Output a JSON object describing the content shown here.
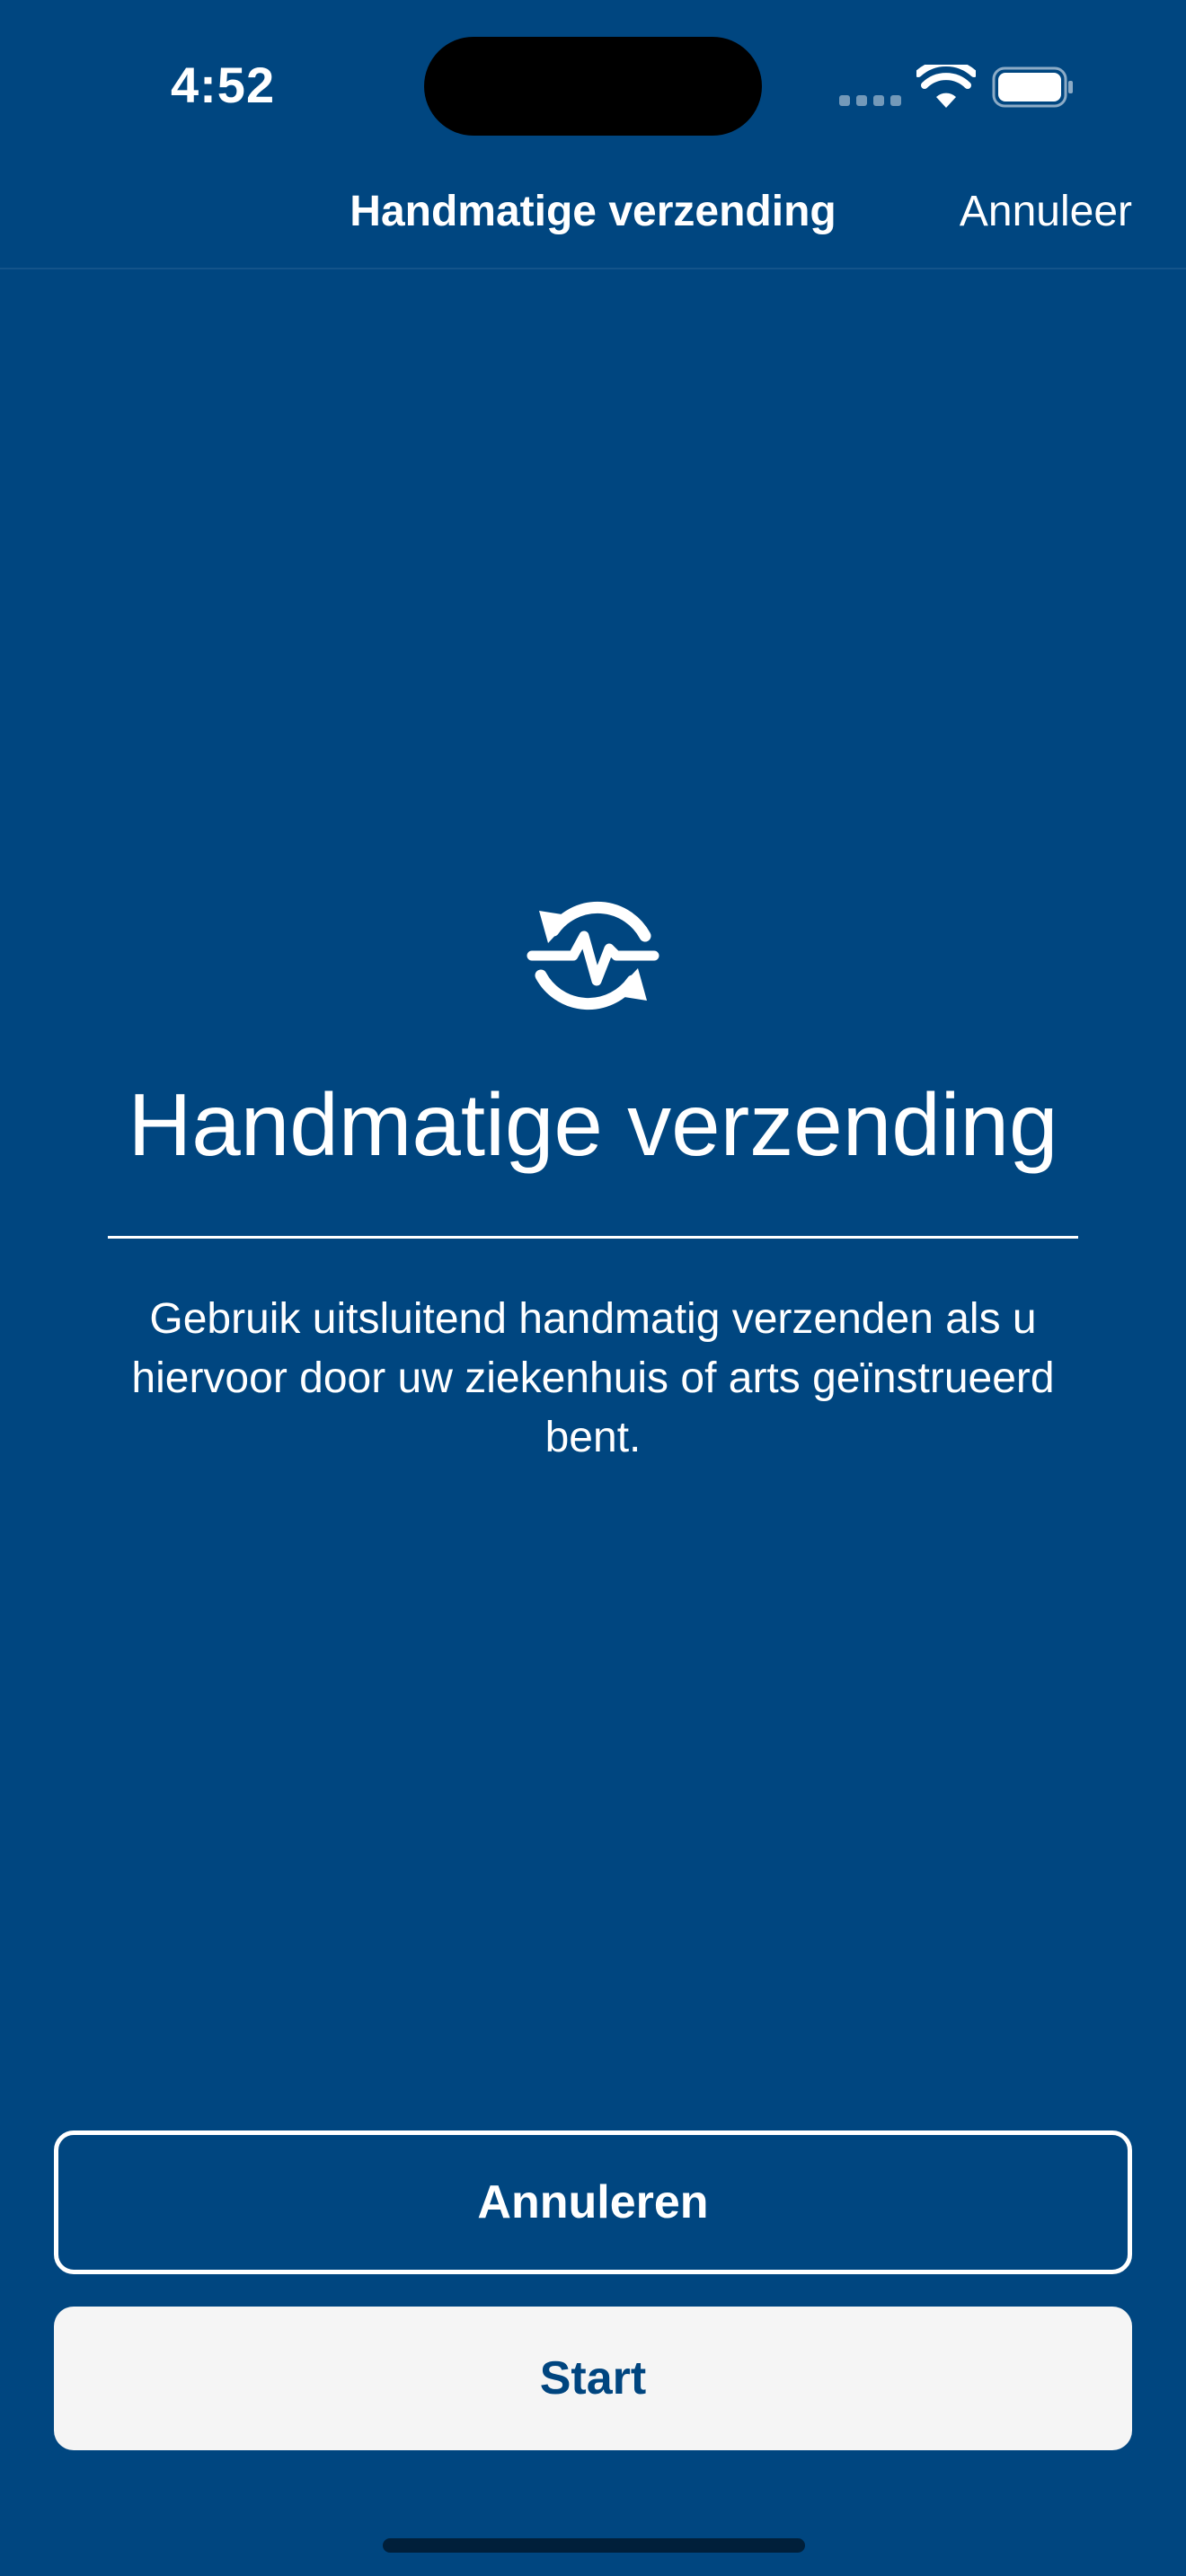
{
  "status_bar": {
    "time": "4:52",
    "signal_icon": "cellular-signal-icon",
    "wifi_icon": "wifi-icon",
    "battery_icon": "battery-icon"
  },
  "nav": {
    "title": "Handmatige verzending",
    "cancel_label": "Annuleer"
  },
  "main": {
    "icon": "sync-heartbeat-icon",
    "title": "Handmatige verzending",
    "description": "Gebruik uitsluitend handmatig verzenden als u hiervoor door uw ziekenhuis of arts geïnstrueerd bent."
  },
  "actions": {
    "cancel_label": "Annuleren",
    "start_label": "Start"
  },
  "colors": {
    "background": "#004680",
    "text": "#ffffff",
    "start_button_bg": "#f5f5f5",
    "start_button_text": "#00457f"
  }
}
